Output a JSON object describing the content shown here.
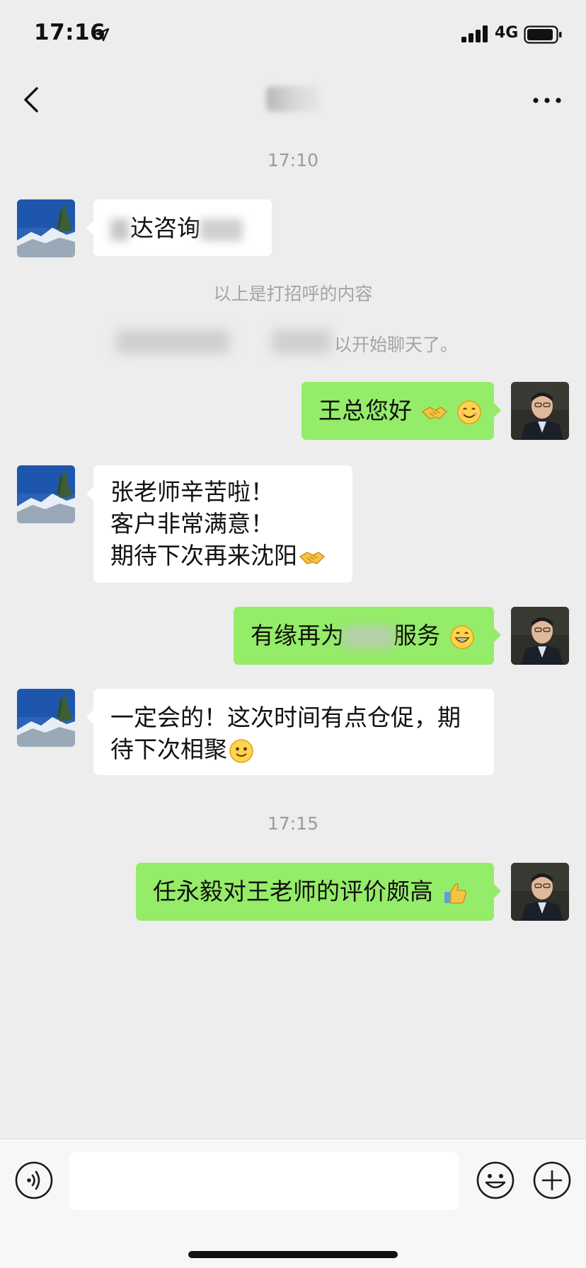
{
  "status_bar": {
    "time": "17:16",
    "network": "4G",
    "location_icon": "location-arrow-icon",
    "signal_icon": "signal-bars-icon",
    "battery_icon": "battery-icon"
  },
  "nav": {
    "back_icon": "chevron-left-icon",
    "more_icon": "more-dots-icon"
  },
  "chat": {
    "timestamps": [
      "17:10",
      "17:15"
    ],
    "system_notes": [
      "以上是打招呼的内容",
      "以开始聊天了。"
    ],
    "messages": [
      {
        "side": "left",
        "lines": [
          "达咨询"
        ],
        "emoji": ""
      },
      {
        "side": "right",
        "lines": [
          "王总您好"
        ],
        "emoji": "handshake-emoji smile-emoji"
      },
      {
        "side": "left",
        "lines": [
          "张老师辛苦啦！",
          "客户非常满意！",
          "期待下次再来沈阳"
        ],
        "emoji": "handshake-emoji"
      },
      {
        "side": "right",
        "lines": [
          "有缘再为",
          "服务"
        ],
        "emoji": "grin-emoji"
      },
      {
        "side": "left",
        "lines": [
          "一定会的！这次时间有点仓促，期",
          "待下次相聚"
        ],
        "emoji": "smile-emoji"
      },
      {
        "side": "right",
        "lines": [
          "任永毅对王老师的评价颇高"
        ],
        "emoji": "thumbs-up-emoji"
      }
    ]
  },
  "input_bar": {
    "voice_icon": "voice-icon",
    "emoji_icon": "emoji-face-icon",
    "add_icon": "plus-circle-icon"
  },
  "colors": {
    "background": "#ededed",
    "outgoing_bubble": "#95ec69",
    "incoming_bubble": "#ffffff",
    "input_bar": "#f7f7f7"
  }
}
